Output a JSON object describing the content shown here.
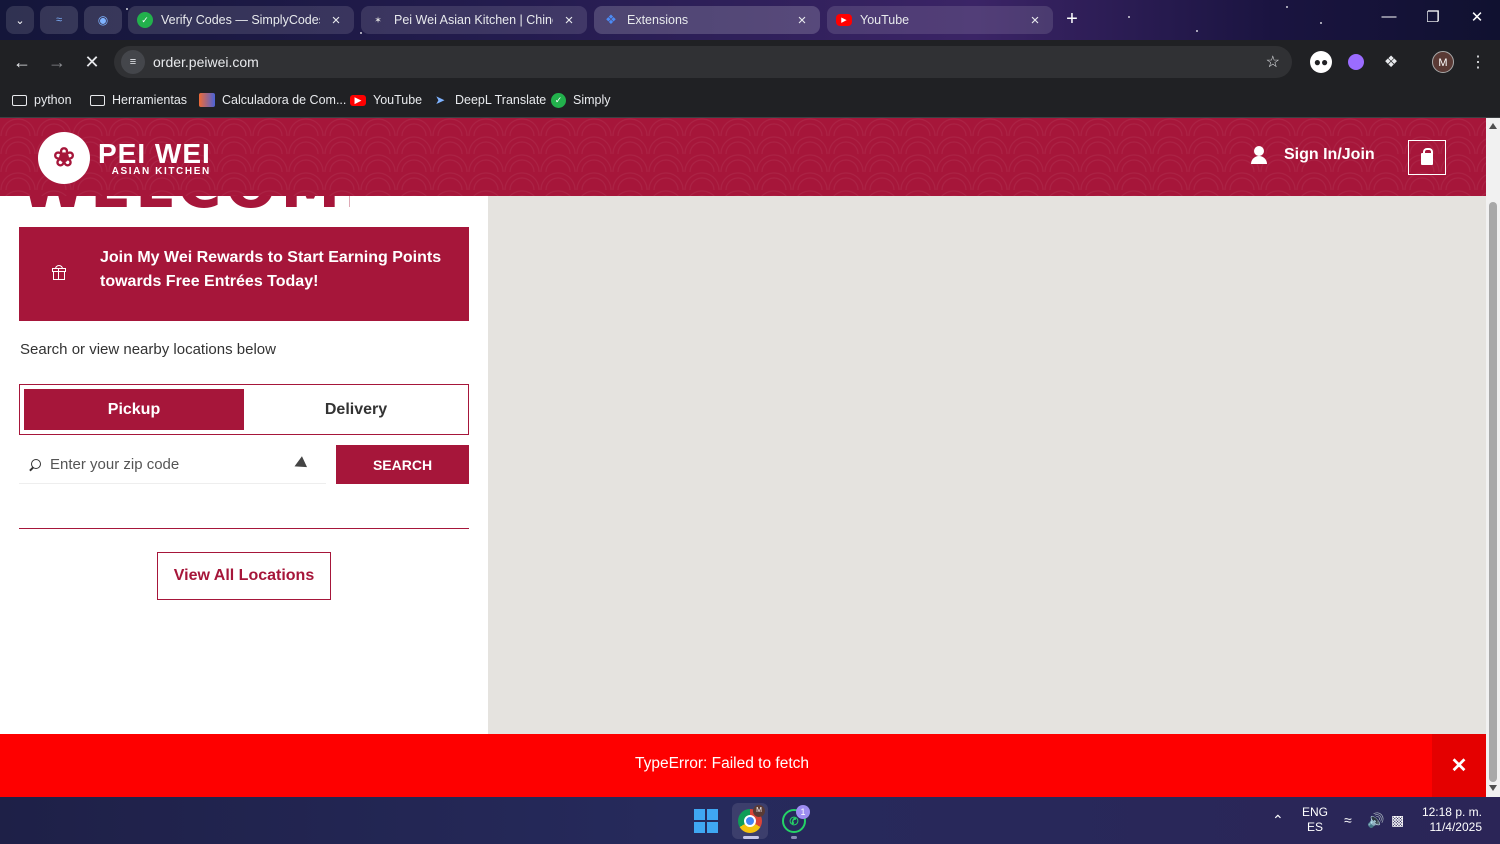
{
  "browser": {
    "tabs": [
      {
        "title": "Verify Codes — SimplyCodes",
        "favicon": "simplycodes-icon"
      },
      {
        "title": "Pei Wei Asian Kitchen | Chinese",
        "favicon": "peiwei-icon"
      },
      {
        "title": "Extensions",
        "favicon": "puzzle-icon"
      },
      {
        "title": "YouTube",
        "favicon": "youtube-icon"
      }
    ],
    "url": "order.peiwei.com",
    "profile_initial": "M",
    "bookmarks": [
      {
        "label": "python",
        "icon": "folder-icon"
      },
      {
        "label": "Herramientas",
        "icon": "folder-icon"
      },
      {
        "label": "Calculadora de Com...",
        "icon": "calculator-icon"
      },
      {
        "label": "YouTube",
        "icon": "youtube-icon"
      },
      {
        "label": "DeepL Translate",
        "icon": "deepl-icon"
      },
      {
        "label": "Simply",
        "icon": "simplycodes-icon"
      }
    ]
  },
  "site": {
    "logo_name": "PEI WEI",
    "logo_sub": "ASIAN KITCHEN",
    "signin_label": "Sign In/Join",
    "welcome_heading": "WELCOME",
    "rewards_text": "Join My Wei Rewards to Start Earning Points towards Free Entrées Today!",
    "search_hint": "Search or view nearby locations below",
    "modes": {
      "pickup": "Pickup",
      "delivery": "Delivery",
      "selected": "Pickup"
    },
    "zip_placeholder": "Enter your zip code",
    "search_label": "SEARCH",
    "view_all_label": "View All Locations",
    "brand_color": "#a6163a"
  },
  "error": {
    "message": "TypeError: Failed to fetch",
    "close_symbol": "✕",
    "color": "#fe0000"
  },
  "taskbar": {
    "whatsapp_badge": "1",
    "chrome_badge": "M",
    "lang_primary": "ENG",
    "lang_secondary": "ES",
    "time": "12:18 p. m.",
    "date": "11/4/2025"
  }
}
